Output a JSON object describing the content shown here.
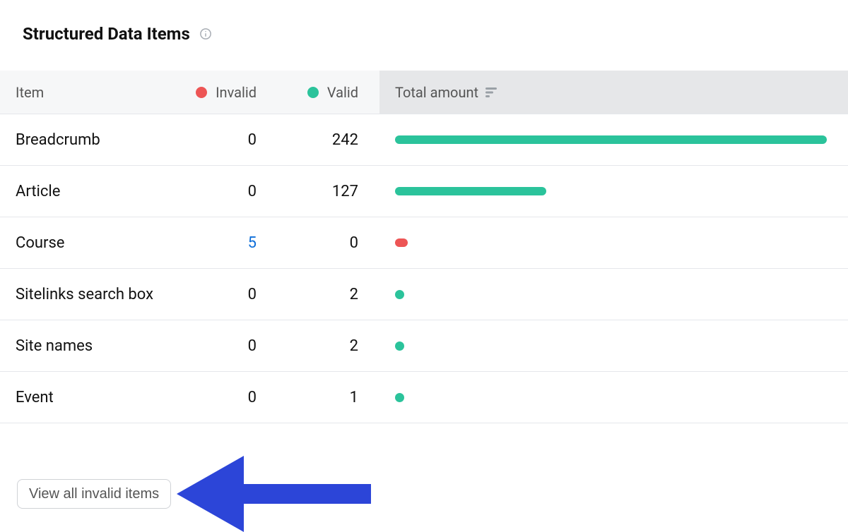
{
  "title": "Structured Data Items",
  "columns": {
    "item": "Item",
    "invalid": "Invalid",
    "valid": "Valid",
    "total": "Total amount"
  },
  "colors": {
    "invalid": "#ed5555",
    "valid": "#2bc39b",
    "link": "#0f6fd9",
    "arrow": "#2c45d8"
  },
  "chart_data": {
    "type": "bar",
    "title": "Structured Data Items",
    "categories": [
      "Breadcrumb",
      "Article",
      "Course",
      "Sitelinks search box",
      "Site names",
      "Event"
    ],
    "series": [
      {
        "name": "Invalid",
        "values": [
          0,
          0,
          5,
          0,
          0,
          0
        ]
      },
      {
        "name": "Valid",
        "values": [
          242,
          127,
          0,
          2,
          2,
          1
        ]
      }
    ],
    "xlabel": "",
    "ylabel": "Total amount",
    "ylim": [
      0,
      242
    ]
  },
  "rows": [
    {
      "name": "Breadcrumb",
      "invalid": 0,
      "valid": 242,
      "invalid_is_link": false,
      "bar_percent": 100,
      "bar_color": "green"
    },
    {
      "name": "Article",
      "invalid": 0,
      "valid": 127,
      "invalid_is_link": false,
      "bar_percent": 35,
      "bar_color": "green"
    },
    {
      "name": "Course",
      "invalid": 5,
      "valid": 0,
      "invalid_is_link": true,
      "bar_percent": 0,
      "bar_color": "red"
    },
    {
      "name": "Sitelinks search box",
      "invalid": 0,
      "valid": 2,
      "invalid_is_link": false,
      "bar_percent": 0,
      "bar_color": "green"
    },
    {
      "name": "Site names",
      "invalid": 0,
      "valid": 2,
      "invalid_is_link": false,
      "bar_percent": 0,
      "bar_color": "green"
    },
    {
      "name": "Event",
      "invalid": 0,
      "valid": 1,
      "invalid_is_link": false,
      "bar_percent": 0,
      "bar_color": "green"
    }
  ],
  "footer": {
    "button_label": "View all invalid items"
  }
}
